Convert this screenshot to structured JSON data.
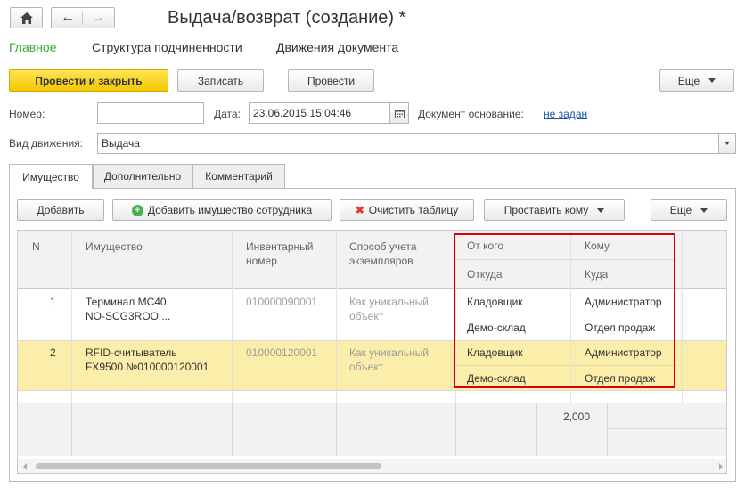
{
  "window": {
    "title": "Выдача/возврат (создание) *"
  },
  "nav_tabs": [
    {
      "label": "Главное"
    },
    {
      "label": "Структура подчиненности"
    },
    {
      "label": "Движения документа"
    }
  ],
  "toolbar": {
    "post_close": "Провести и закрыть",
    "save": "Записать",
    "post": "Провести",
    "more": "Еще"
  },
  "form": {
    "number_label": "Номер:",
    "number_value": "",
    "date_label": "Дата:",
    "date_value": "23.06.2015 15:04:46",
    "base_doc_label": "Документ основание:",
    "base_doc_link": "не задан",
    "movement_label": "Вид движения:",
    "movement_value": "Выдача"
  },
  "content_tabs": [
    {
      "label": "Имущество"
    },
    {
      "label": "Дополнительно"
    },
    {
      "label": "Комментарий"
    }
  ],
  "table_toolbar": {
    "add": "Добавить",
    "add_employee": "Добавить имущество сотрудника",
    "clear": "Очистить таблицу",
    "assign_to": "Проставить кому",
    "more": "Еще"
  },
  "table": {
    "headers": {
      "n": "N",
      "item": "Имущество",
      "inv": [
        "Инвентарный",
        "номер"
      ],
      "method": [
        "Способ учета",
        "экземпляров"
      ],
      "from_whom": "От кого",
      "from_where": "Откуда",
      "to_whom": "Кому",
      "to_where": "Куда"
    },
    "rows": [
      {
        "n": "1",
        "item": [
          "Терминал МС40",
          "NO-SCG3ROO ..."
        ],
        "inv": "010000090001",
        "method": [
          "Как уникальный",
          "объект"
        ],
        "from_whom": "Кладовщик",
        "from_where": "Демо-склад",
        "to_whom": "Администратор",
        "to_where": "Отдел продаж"
      },
      {
        "n": "2",
        "item": [
          "RFID-считыватель",
          "FX9500 №010000120001"
        ],
        "inv": "010000120001",
        "method": [
          "Как уникальный",
          "объект"
        ],
        "from_whom": "Кладовщик",
        "from_where": "Демо-склад",
        "to_whom": "Администратор",
        "to_where": "Отдел продаж"
      }
    ],
    "footer_total": "2,000"
  },
  "colors": {
    "accent_green": "#38a838",
    "primary_yellow": "#f5c800",
    "selected_row": "#fbeeaa",
    "highlight_border": "#d9000d",
    "link": "#1b55a8"
  }
}
